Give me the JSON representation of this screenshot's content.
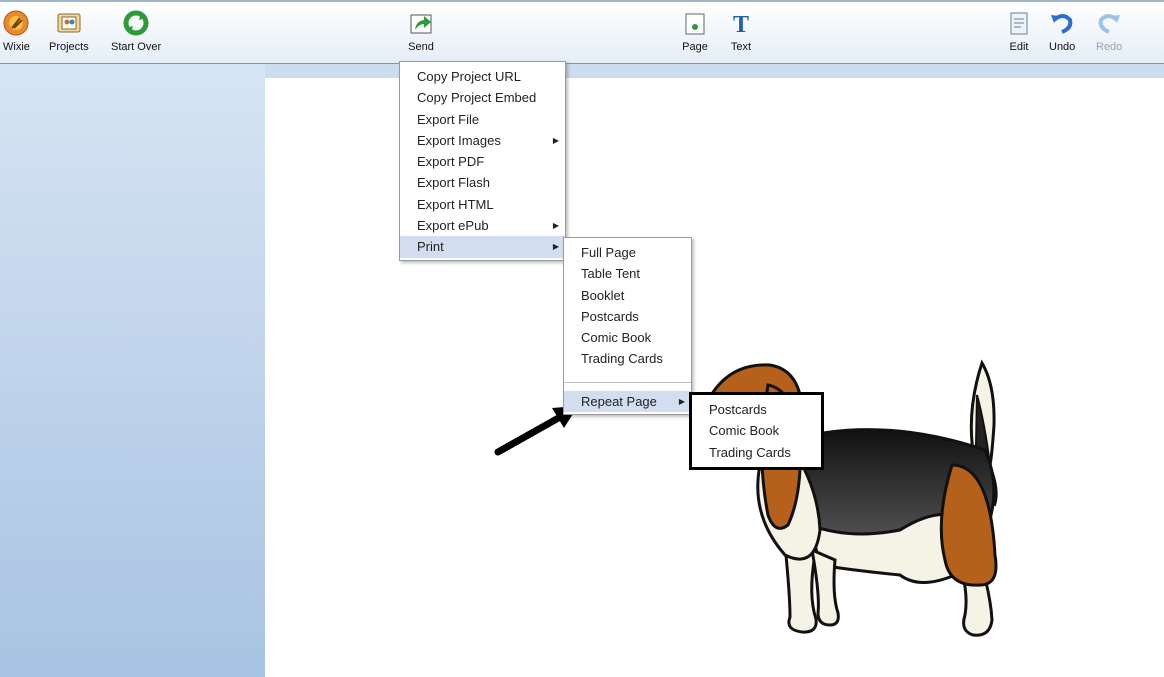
{
  "toolbar": {
    "wixie": {
      "label": "Wixie",
      "icon": "wixie-logo-icon"
    },
    "projects": {
      "label": "Projects",
      "icon": "projects-icon"
    },
    "start_over": {
      "label": "Start Over",
      "icon": "start-over-icon"
    },
    "send": {
      "label": "Send",
      "icon": "send-icon"
    },
    "page": {
      "label": "Page",
      "icon": "page-icon"
    },
    "text": {
      "label": "Text",
      "icon": "text-icon"
    },
    "edit": {
      "label": "Edit",
      "icon": "edit-icon"
    },
    "undo": {
      "label": "Undo",
      "icon": "undo-icon"
    },
    "redo": {
      "label": "Redo",
      "icon": "redo-icon",
      "disabled": true
    }
  },
  "send_menu": {
    "items": [
      {
        "label": "Copy Project URL"
      },
      {
        "label": "Copy Project Embed"
      },
      {
        "label": "Export File"
      },
      {
        "label": "Export Images",
        "submenu": true
      },
      {
        "label": "Export PDF"
      },
      {
        "label": "Export Flash"
      },
      {
        "label": "Export HTML"
      },
      {
        "label": "Export ePub",
        "submenu": true
      },
      {
        "label": "Print",
        "submenu": true,
        "selected": true
      }
    ]
  },
  "print_menu": {
    "items": [
      {
        "label": "Full Page"
      },
      {
        "label": "Table Tent"
      },
      {
        "label": "Booklet"
      },
      {
        "label": "Postcards"
      },
      {
        "label": "Comic Book"
      },
      {
        "label": "Trading Cards"
      }
    ],
    "repeat_page": {
      "label": "Repeat Page",
      "submenu": true,
      "selected": true
    }
  },
  "repeat_page_menu": {
    "items": [
      {
        "label": "Postcards"
      },
      {
        "label": "Comic Book"
      },
      {
        "label": "Trading Cards"
      }
    ]
  },
  "canvas": {
    "image": "beagle-dog-illustration",
    "annotation": "arrow-pointing-to-repeat-page"
  },
  "colors": {
    "toolbar_bg": "#e4edf7",
    "sidebar_bg": "#a8c3e3",
    "menu_highlight": "#d2deef",
    "icon_green": "#2e9b3a",
    "icon_blue": "#2a6fc9"
  }
}
